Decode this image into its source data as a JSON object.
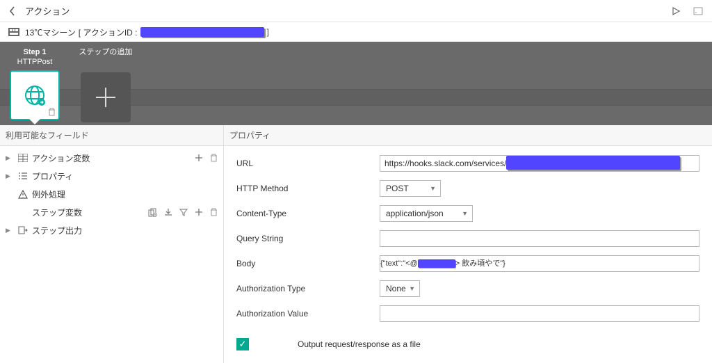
{
  "header": {
    "title": "アクション"
  },
  "subheader": {
    "machine": "13℃マシーン",
    "action_id_label": "[ アクションID :",
    "closing": "]"
  },
  "steps": {
    "step1_name": "Step 1",
    "step1_type": "HTTPPost",
    "add_label": "ステップの追加"
  },
  "sidebar": {
    "title": "利用可能なフィールド",
    "items": [
      "アクション変数",
      "プロパティ",
      "例外処理",
      "ステップ変数",
      "ステップ出力"
    ]
  },
  "props": {
    "title": "プロパティ",
    "url_label": "URL",
    "url_value": "https://hooks.slack.com/services/T",
    "method_label": "HTTP Method",
    "method_value": "POST",
    "ct_label": "Content-Type",
    "ct_value": "application/json",
    "qs_label": "Query String",
    "qs_value": "",
    "body_label": "Body",
    "body_prefix": "{\"text\":\"<@",
    "body_suffix": "> 飲み頃やで\"}",
    "auth_type_label": "Authorization Type",
    "auth_type_value": "None",
    "auth_val_label": "Authorization Value",
    "auth_val_value": "",
    "output_file_label": "Output request/response as a file"
  }
}
